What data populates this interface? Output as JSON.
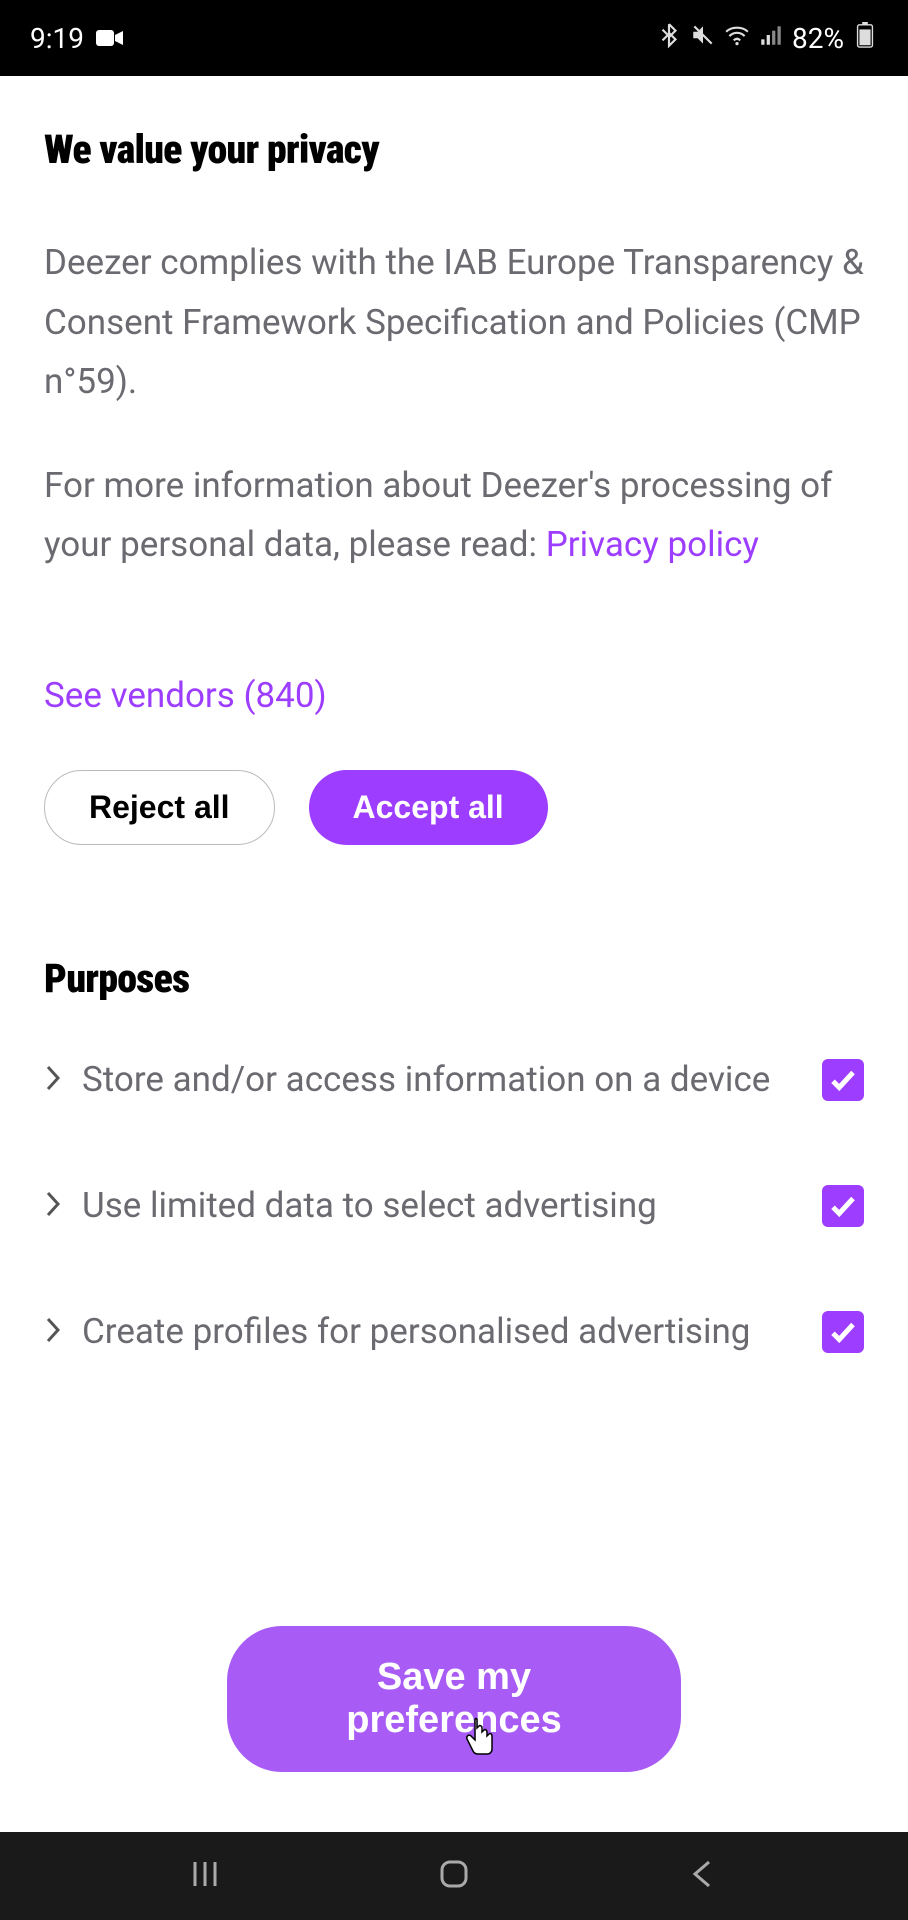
{
  "status": {
    "time": "9:19",
    "battery": "82%"
  },
  "header": {
    "title": "We value your privacy"
  },
  "body": {
    "para1": "Deezer complies with the IAB Europe Transparency & Consent Framework Specification and Policies (CMP n°59).",
    "para2_prefix": "For more information about Deezer's processing of your personal data, please read: ",
    "privacy_link": "Privacy policy",
    "vendors_label": "See vendors (840)",
    "reject_label": "Reject all",
    "accept_label": "Accept all"
  },
  "purposes": {
    "heading": "Purposes",
    "items": [
      {
        "label": "Store and/or access information on a device",
        "checked": true
      },
      {
        "label": "Use limited data to select advertising",
        "checked": true
      },
      {
        "label": "Create profiles for personalised advertising",
        "checked": true
      }
    ]
  },
  "footer": {
    "save_label": "Save my preferences"
  }
}
